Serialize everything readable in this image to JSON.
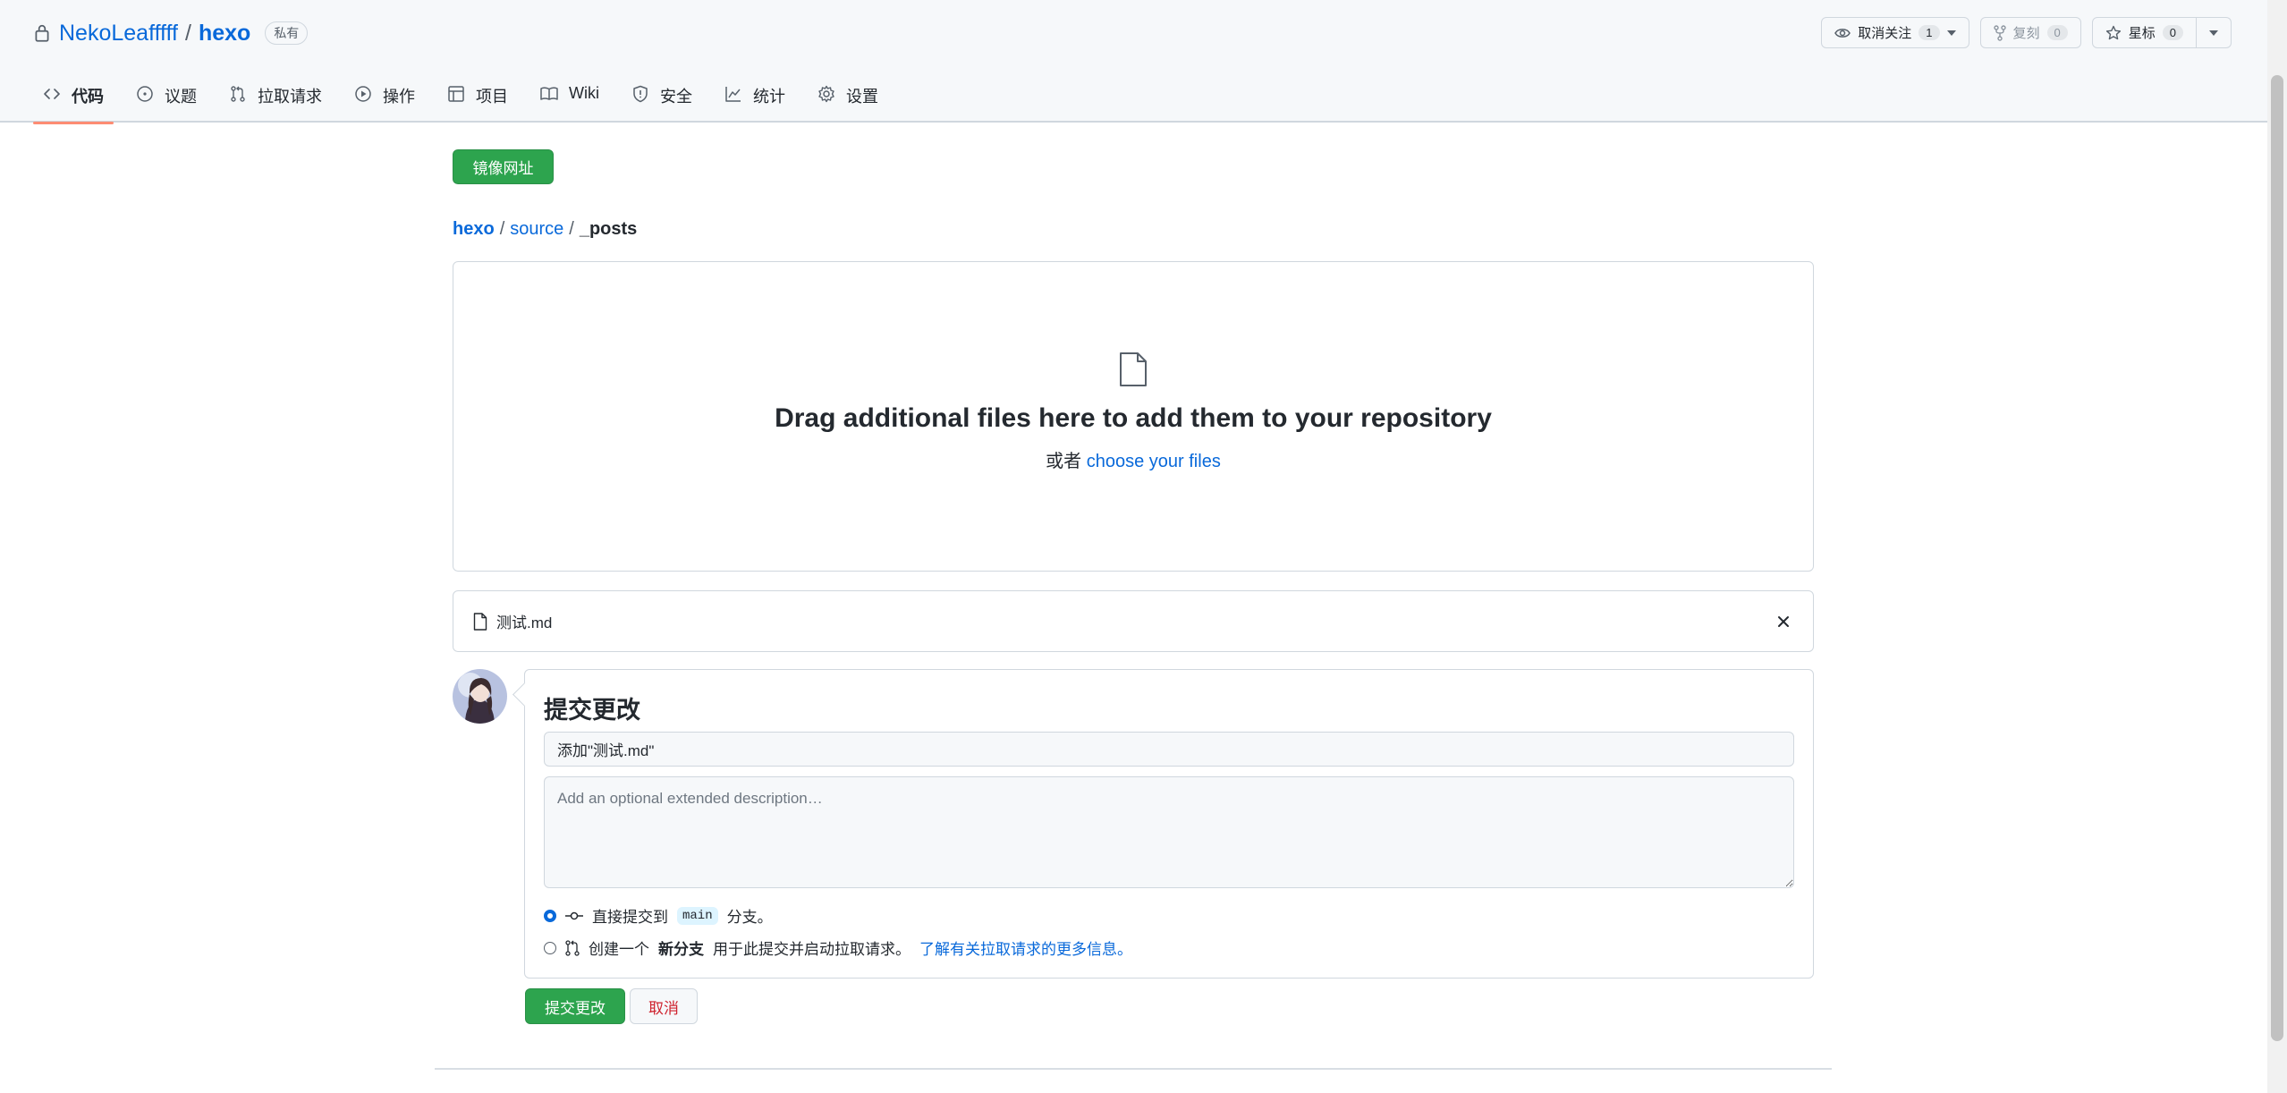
{
  "header": {
    "owner": "NekoLeafffff",
    "separator": "/",
    "repo": "hexo",
    "visibility_badge": "私有",
    "watch": {
      "label": "取消关注",
      "count": "1"
    },
    "fork": {
      "label": "复刻",
      "count": "0"
    },
    "star": {
      "label": "星标",
      "count": "0"
    }
  },
  "tabs": [
    {
      "label": "代码",
      "icon": "code-icon",
      "selected": true
    },
    {
      "label": "议题",
      "icon": "issue-icon"
    },
    {
      "label": "拉取请求",
      "icon": "pull-request-icon"
    },
    {
      "label": "操作",
      "icon": "play-icon"
    },
    {
      "label": "项目",
      "icon": "table-icon"
    },
    {
      "label": "Wiki",
      "icon": "book-icon"
    },
    {
      "label": "安全",
      "icon": "shield-icon"
    },
    {
      "label": "统计",
      "icon": "graph-icon"
    },
    {
      "label": "设置",
      "icon": "gear-icon"
    }
  ],
  "mirror_button": "镜像网址",
  "breadcrumb": {
    "root": "hexo",
    "sep": "/",
    "folder": "source",
    "current": "_posts"
  },
  "dropzone": {
    "title": "Drag additional files here to add them to your repository",
    "or": "或者",
    "choose": "choose your files"
  },
  "file": {
    "name": "测试.md"
  },
  "commit": {
    "title": "提交更改",
    "summary_value": "添加\"测试.md\"",
    "description_placeholder": "Add an optional extended description…",
    "option_direct_prefix": "直接提交到",
    "branch": "main",
    "option_direct_suffix": "分支。",
    "option_new_prefix": "创建一个",
    "option_new_bold": "新分支",
    "option_new_suffix": "用于此提交并启动拉取请求。",
    "learn_more": "了解有关拉取请求的更多信息。",
    "submit": "提交更改",
    "cancel": "取消"
  },
  "colors": {
    "primary_green": "#2da44e",
    "link_blue": "#0969da",
    "tab_underline": "#fd8c73",
    "danger_red": "#cf222e"
  }
}
